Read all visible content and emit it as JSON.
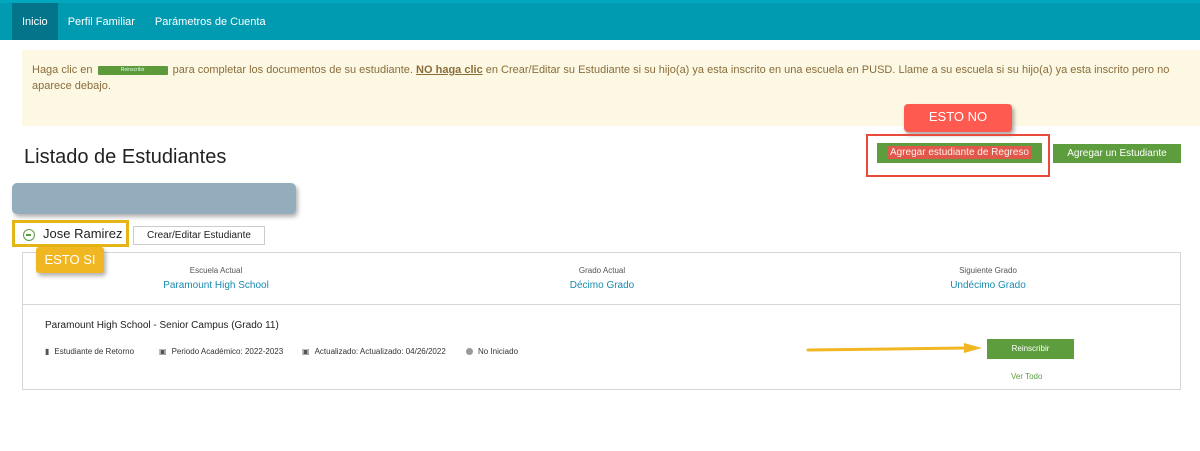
{
  "nav": {
    "items": [
      {
        "label": "Inicio"
      },
      {
        "label": "Perfil Familiar"
      },
      {
        "label": "Parámetros de Cuenta"
      }
    ]
  },
  "alert": {
    "prefix": "Haga clic en",
    "inline_button": "Reinscribir",
    "middle": "para completar los documentos de su estudiante.",
    "emph": "NO haga clic",
    "suffix": "en Crear/Editar su Estudiante si su hijo(a) ya esta inscrito en una escuela en PUSD. Llame a su escuela si su hijo(a) ya esta inscrito pero no aparece debajo."
  },
  "annotations": {
    "esto_no": "ESTO NO",
    "esto_si": "ESTO SI"
  },
  "header": {
    "title": "Listado de Estudiantes",
    "btn_regreso": "Agregar estudiante de Regreso",
    "btn_agregar": "Agregar un Estudiante"
  },
  "student": {
    "name": "Jose Ramirez",
    "edit_label": "Crear/Editar Estudiante",
    "columns": [
      {
        "label": "Escuela Actual",
        "value": "Paramount High School"
      },
      {
        "label": "Grado Actual",
        "value": "Décimo Grado"
      },
      {
        "label": "Siguiente Grado",
        "value": "Undécimo Grado"
      }
    ],
    "enrollment": {
      "school": "Paramount High School - Senior Campus (Grado 11)",
      "type": "Estudiante de Retorno",
      "period": "Periodo Académico: 2022-2023",
      "updated": "Actualizado: Actualizado: 04/26/2022",
      "status": "No Iniciado",
      "reinscribir": "Reinscribir",
      "ver_todo": "Ver Todo"
    }
  },
  "colors": {
    "topbar": "#009bb1",
    "green": "#5d9d3e",
    "callout_red": "#ff5a4f",
    "callout_yellow": "#f1b722"
  }
}
